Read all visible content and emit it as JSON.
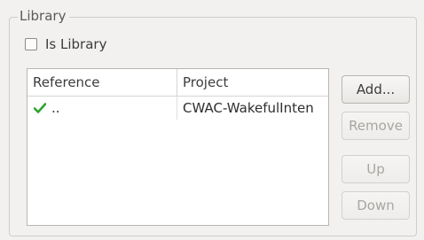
{
  "group": {
    "title": "Library"
  },
  "is_library": {
    "label": "Is Library",
    "checked": false
  },
  "table": {
    "columns": [
      "Reference",
      "Project"
    ],
    "rows": [
      {
        "status_icon": "checkmark-icon",
        "reference": "..",
        "project": "CWAC-WakefulInten"
      }
    ]
  },
  "buttons": {
    "add": "Add...",
    "remove": "Remove",
    "up": "Up",
    "down": "Down"
  },
  "colors": {
    "check": "#2fa32f",
    "disabled_text": "#a8a6a2"
  }
}
